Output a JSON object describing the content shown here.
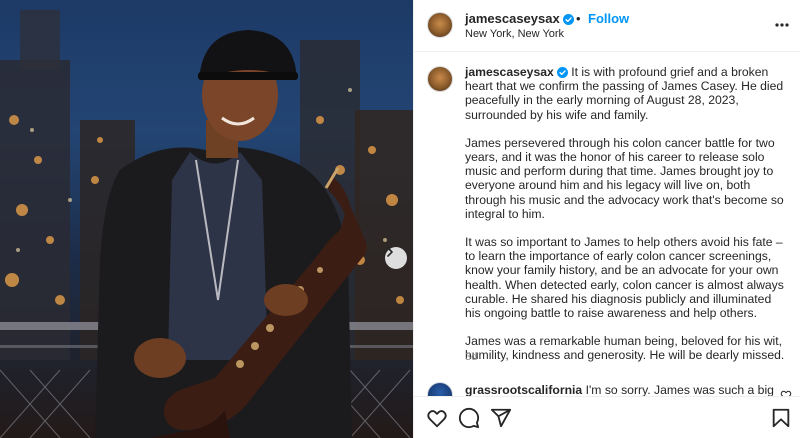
{
  "post": {
    "username": "jamescaseysax",
    "separator": "•",
    "follow_label": "Follow",
    "location": "New York, New York"
  },
  "caption": {
    "username": "jamescaseysax",
    "paragraphs": [
      "It is with profound grief and a broken heart that we confirm the passing of James Casey. He died peacefully in the early morning of August 28, 2023, surrounded by his wife and family.",
      "James persevered through his colon cancer battle for two years, and it was the honor of his career to release solo music and perform during that time. James brought joy to everyone around him and his legacy will live on, both through his music and the advocacy work that's become so integral to him.",
      "It was so important to James to help others avoid his fate – to learn the importance of early colon cancer screenings, know your family history, and be an advocate for your own health. When detected early, colon cancer is almost always curable. He shared his diagnosis publicly and illuminated his ongoing battle to raise awareness and help others.",
      "James was a remarkable human being, beloved for his wit, humility, kindness and generosity. He will be dearly missed."
    ],
    "age": "3d"
  },
  "comments": [
    {
      "username": "grassrootscalifornia",
      "text": "I'm so sorry. James was such a big"
    }
  ],
  "icons": {
    "verified": "verified-badge-icon",
    "more": "more-options-icon",
    "like": "heart-icon",
    "comment": "comment-icon",
    "share": "share-icon",
    "save": "bookmark-icon",
    "next": "chevron-right-icon"
  },
  "colors": {
    "accent": "#0095f6",
    "text": "#262626",
    "muted": "#8e8e8e",
    "divider": "#efefef"
  }
}
